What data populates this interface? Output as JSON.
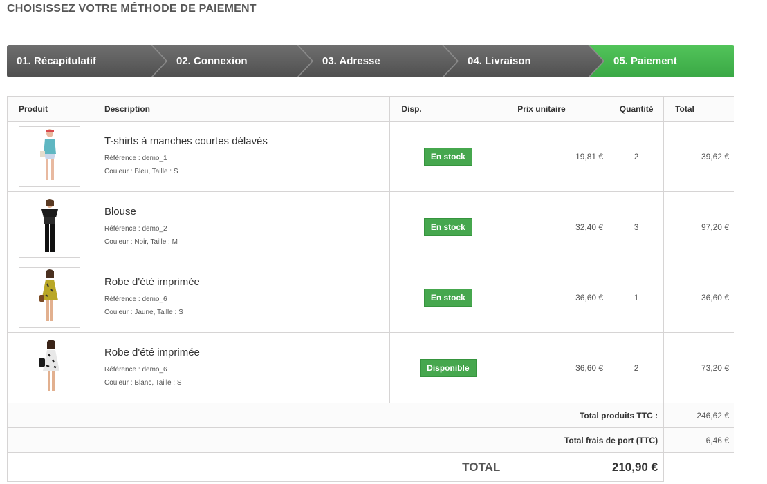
{
  "page": {
    "title": "CHOISISSEZ VOTRE MÉTHODE DE PAIEMENT"
  },
  "steps": [
    {
      "label": "01. Récapitulatif"
    },
    {
      "label": "02. Connexion"
    },
    {
      "label": "03. Adresse"
    },
    {
      "label": "04. Livraison"
    },
    {
      "label": "05. Paiement"
    }
  ],
  "table": {
    "headers": {
      "product": "Produit",
      "description": "Description",
      "availability": "Disp.",
      "unit_price": "Prix unitaire",
      "quantity": "Quantité",
      "total": "Total"
    },
    "rows": [
      {
        "name": "T-shirts à manches courtes délavés",
        "ref": "Référence : demo_1",
        "attrs": "Couleur : Bleu, Taille : S",
        "availability": "En stock",
        "unit_price": "19,81 €",
        "quantity": "2",
        "total": "39,62 €"
      },
      {
        "name": "Blouse",
        "ref": "Référence : demo_2",
        "attrs": "Couleur : Noir, Taille : M",
        "availability": "En stock",
        "unit_price": "32,40 €",
        "quantity": "3",
        "total": "97,20 €"
      },
      {
        "name": "Robe d'été imprimée",
        "ref": "Référence : demo_6",
        "attrs": "Couleur : Jaune, Taille : S",
        "availability": "En stock",
        "unit_price": "36,60 €",
        "quantity": "1",
        "total": "36,60 €"
      },
      {
        "name": "Robe d'été imprimée",
        "ref": "Référence : demo_6",
        "attrs": "Couleur : Blanc, Taille : S",
        "availability": "Disponible",
        "unit_price": "36,60 €",
        "quantity": "2",
        "total": "73,20 €"
      }
    ]
  },
  "summary": {
    "products_label": "Total produits TTC :",
    "products_value": "246,62 €",
    "shipping_label": "Total frais de port (TTC)",
    "shipping_value": "6,46 €",
    "total_label": "TOTAL",
    "total_value": "210,90 €"
  },
  "colors": {
    "accent_green": "#46a74e",
    "step_gray": "#5f5f5f"
  }
}
